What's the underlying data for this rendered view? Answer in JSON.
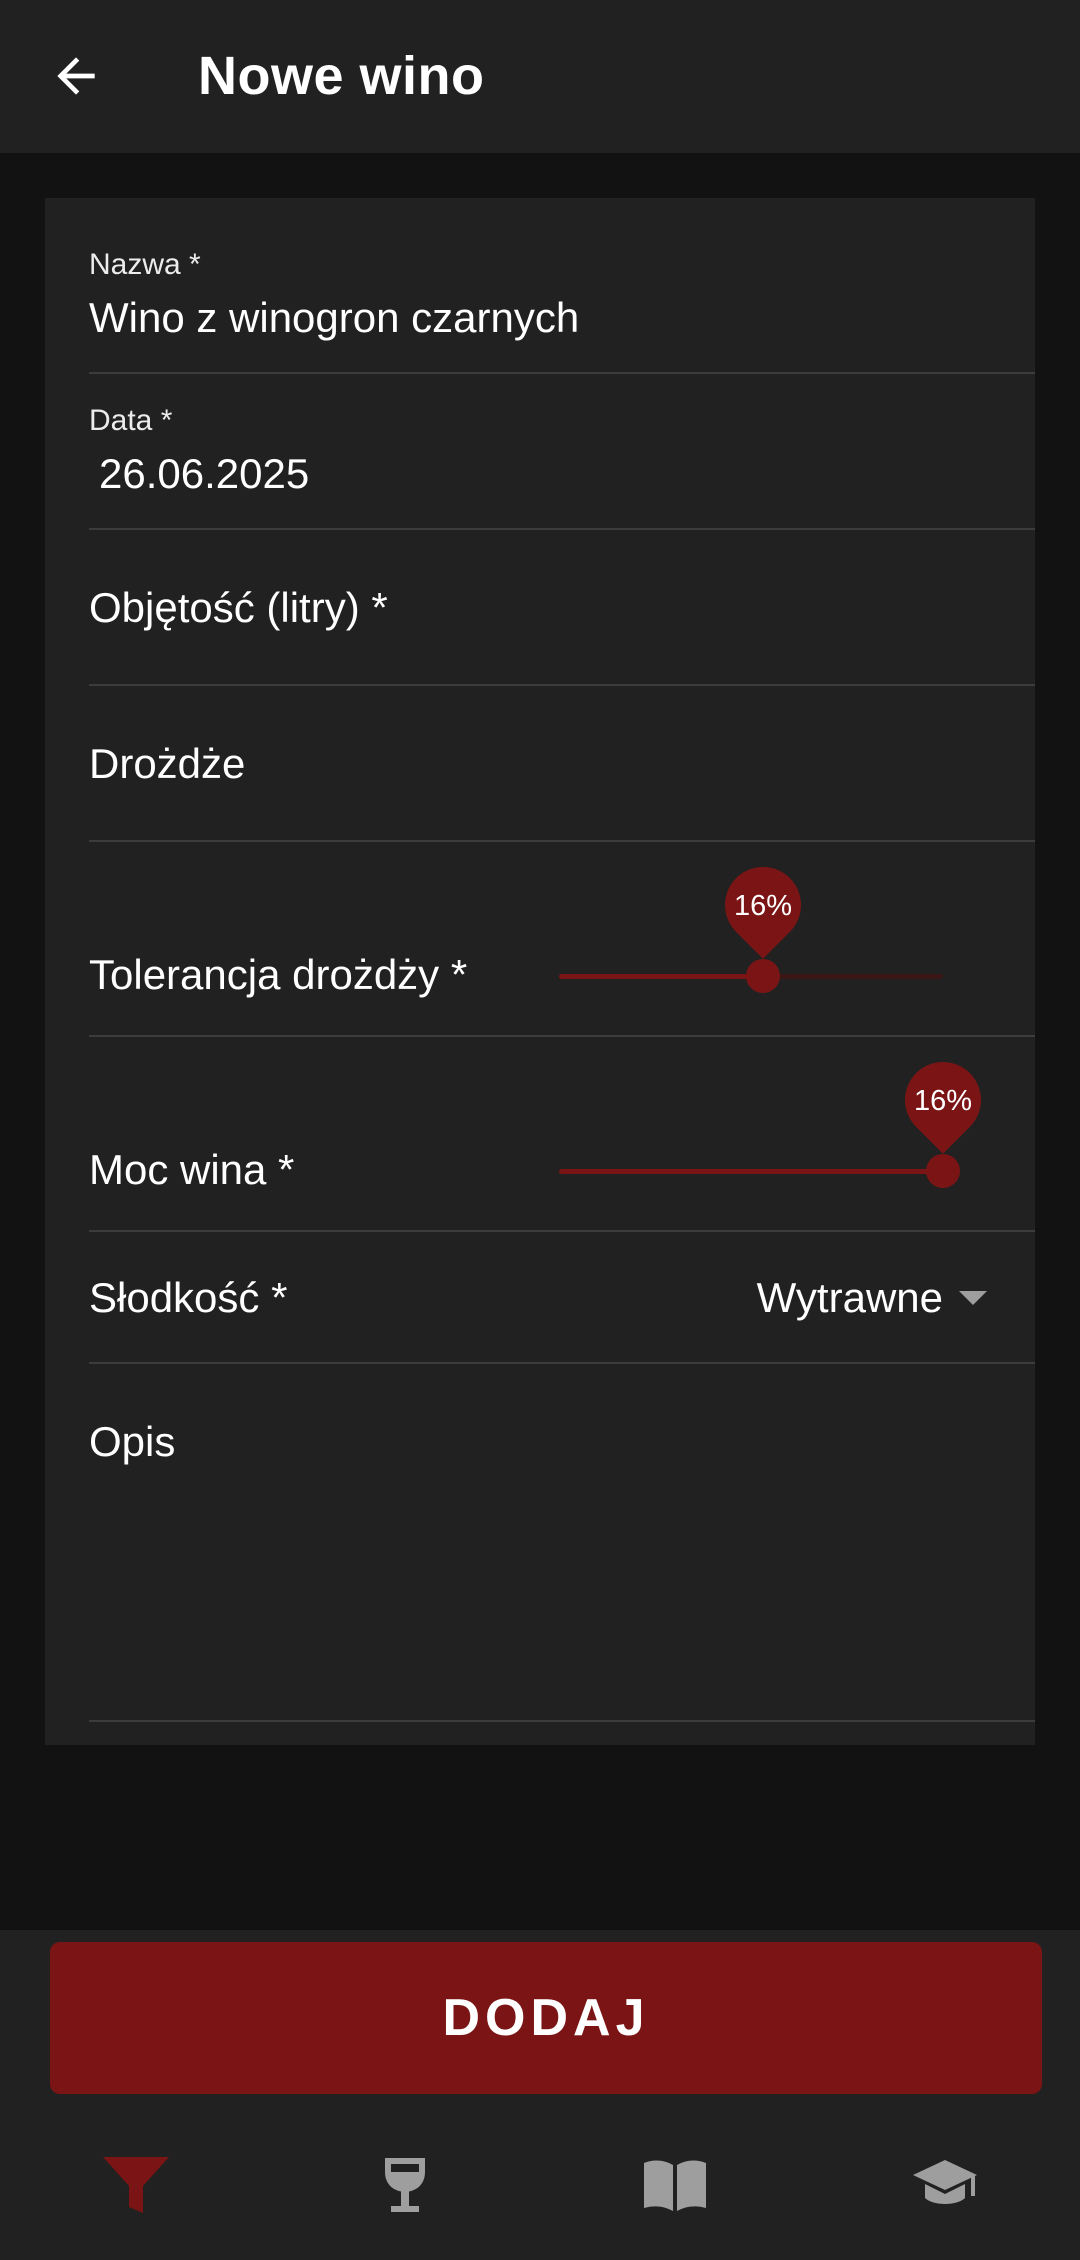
{
  "app_bar": {
    "title": "Nowe wino",
    "back_icon": "arrow-back-icon"
  },
  "form": {
    "name": {
      "label": "Nazwa *",
      "value": "Wino z winogron czarnych"
    },
    "date": {
      "label": "Data *",
      "value": "26.06.2025"
    },
    "volume": {
      "label": "Objętość (litry) *",
      "value": ""
    },
    "yeast": {
      "label": "Drożdże",
      "value": ""
    },
    "yeast_tolerance": {
      "label": "Tolerancja drożdży *",
      "value_label": "16%",
      "fraction": 0.53
    },
    "wine_strength": {
      "label": "Moc wina *",
      "value_label": "16%",
      "fraction": 1.0
    },
    "sweetness": {
      "label": "Słodkość *",
      "selected": "Wytrawne"
    },
    "description": {
      "label": "Opis",
      "value": ""
    }
  },
  "add_button": {
    "label": "DODAJ"
  },
  "bottom_nav": [
    {
      "icon": "filter-funnel-icon",
      "active": true
    },
    {
      "icon": "wine-glass-icon",
      "active": false
    },
    {
      "icon": "open-book-icon",
      "active": false
    },
    {
      "icon": "graduation-cap-icon",
      "active": false
    }
  ],
  "colors": {
    "accent": "#7b1515",
    "surface": "#212121",
    "background": "#121212",
    "divider": "#3c3c3c",
    "inactive_icon": "#9e9e9e"
  }
}
